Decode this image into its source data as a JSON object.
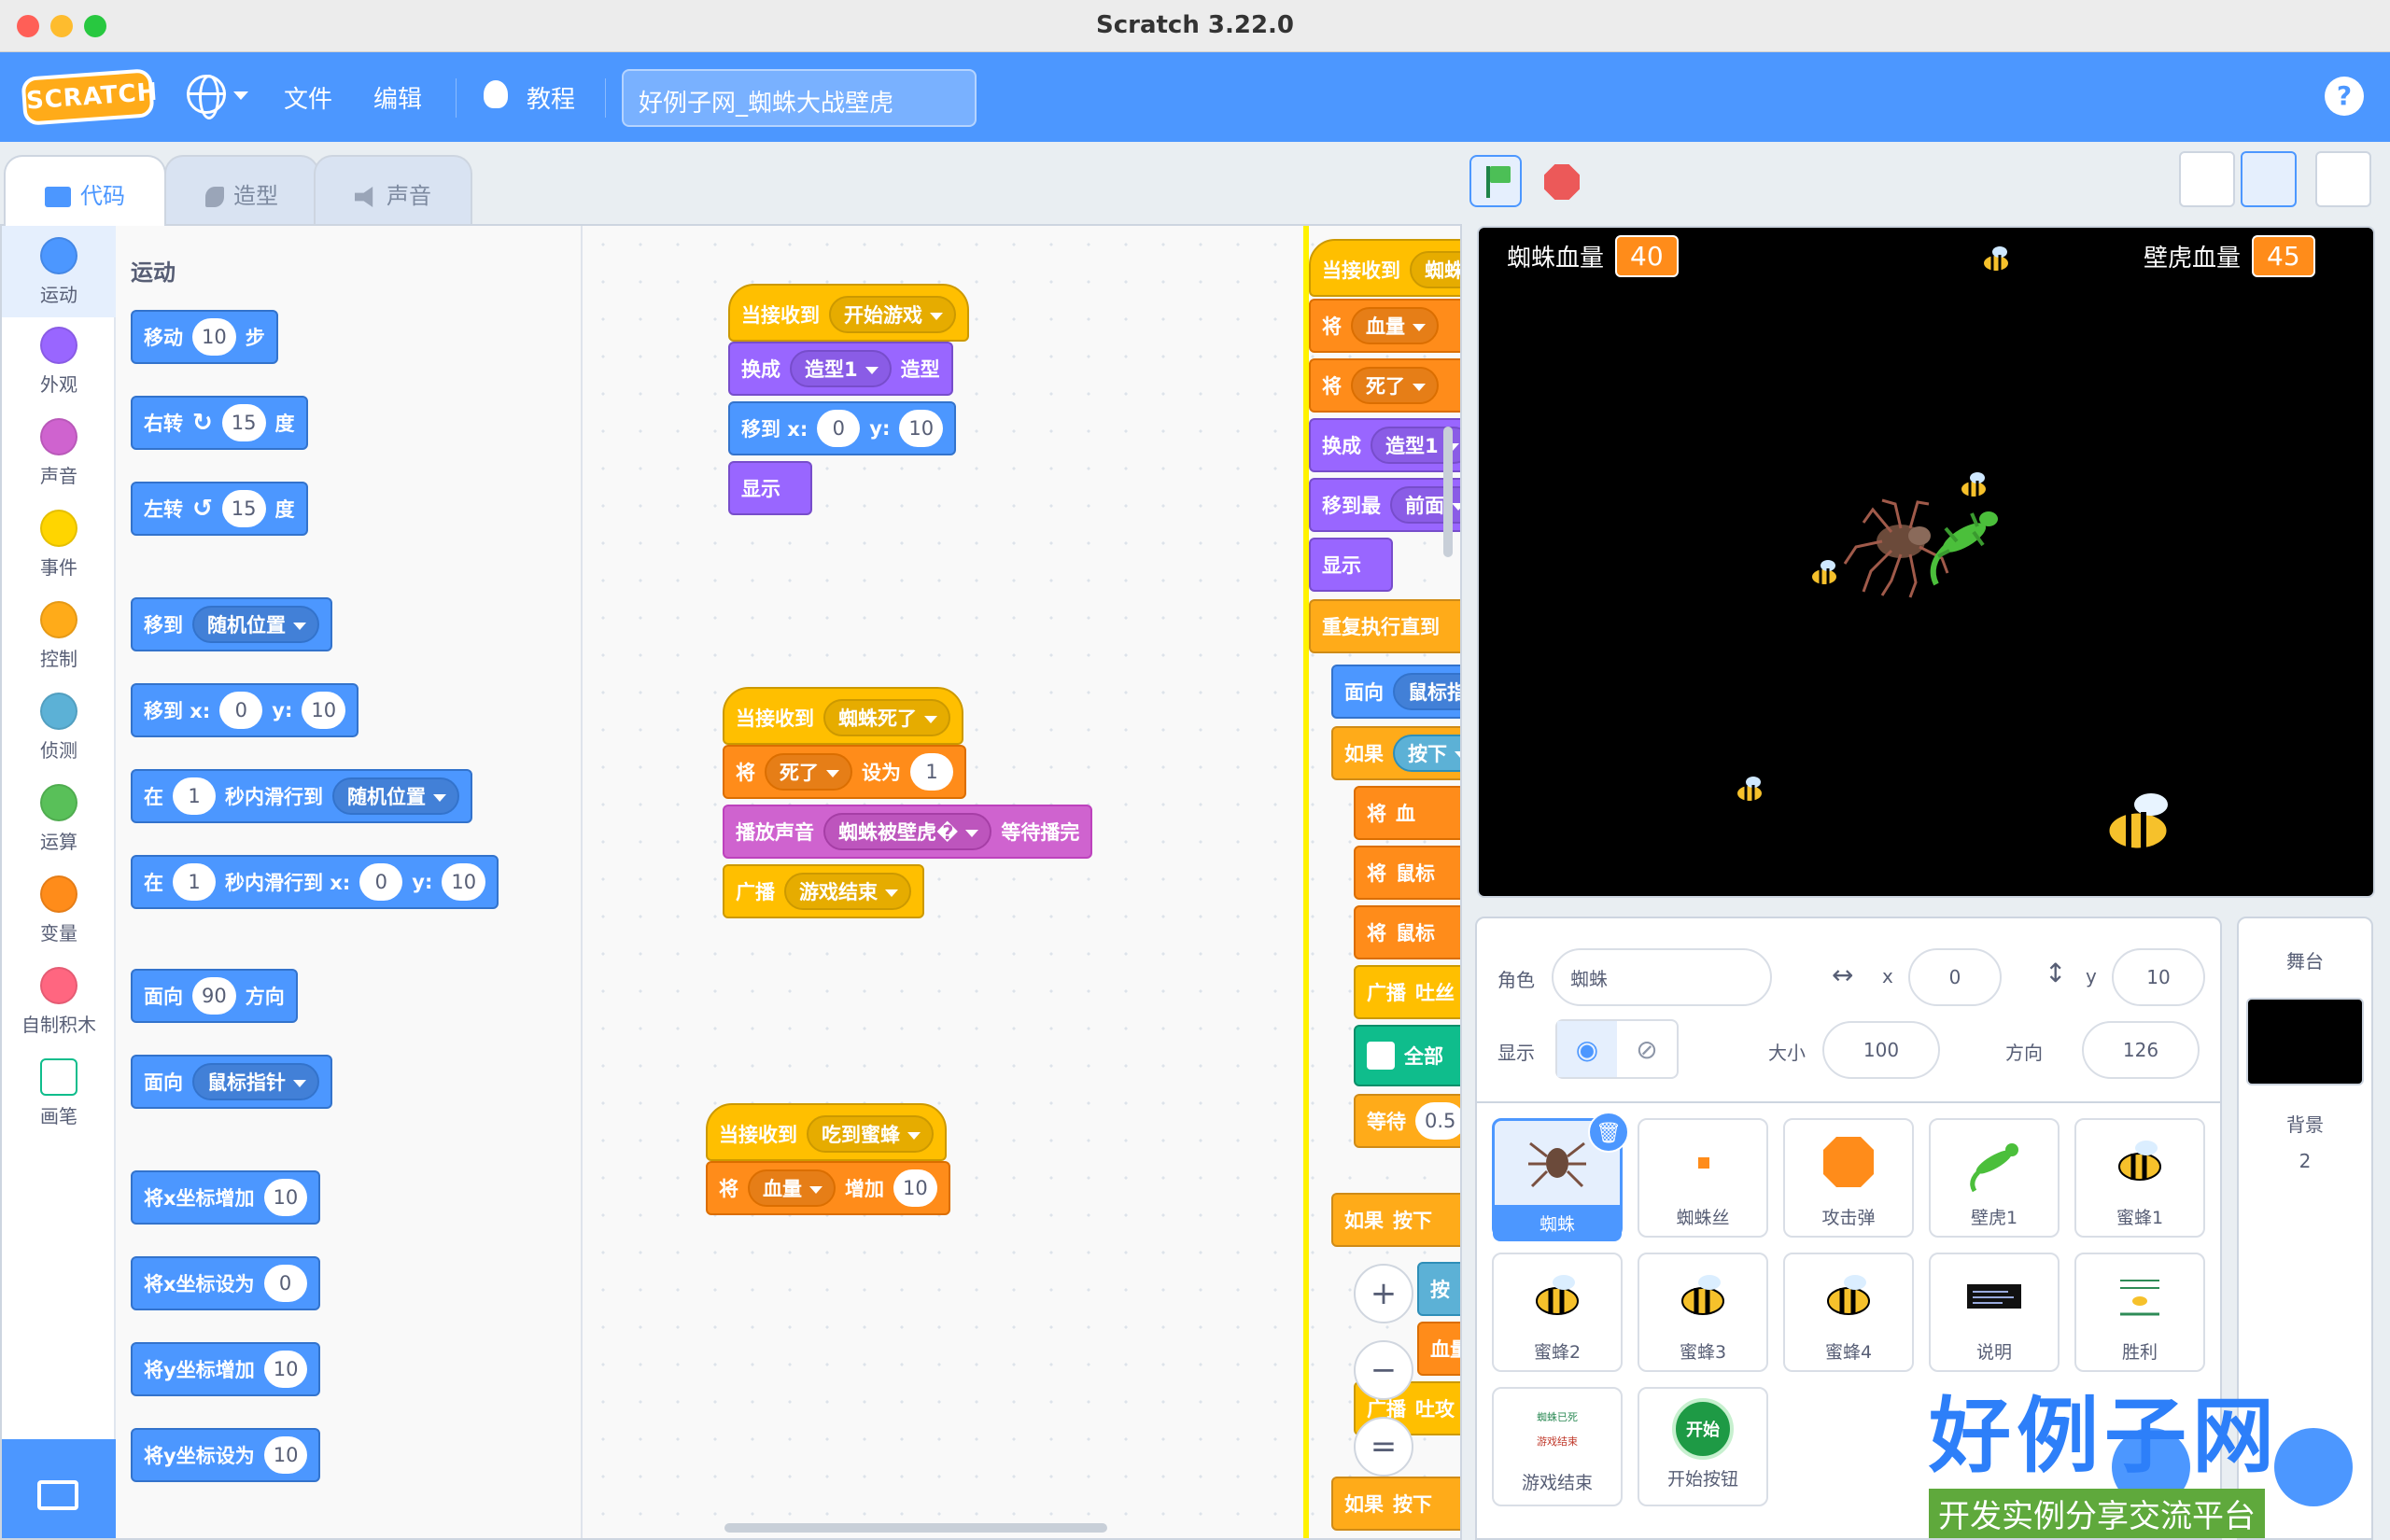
{
  "window": {
    "title": "Scratch 3.22.0"
  },
  "menubar": {
    "logo": "SCRATCH",
    "file": "文件",
    "edit": "编辑",
    "tutorials": "教程",
    "project_title": "好例子网_蜘蛛大战壁虎",
    "help": "?"
  },
  "tabs": {
    "code": "代码",
    "costumes": "造型",
    "sounds": "声音"
  },
  "categories": [
    {
      "label": "运动",
      "color": "#4c97ff"
    },
    {
      "label": "外观",
      "color": "#9966ff"
    },
    {
      "label": "声音",
      "color": "#cf63cf"
    },
    {
      "label": "事件",
      "color": "#ffd500"
    },
    {
      "label": "控制",
      "color": "#ffab19"
    },
    {
      "label": "侦测",
      "color": "#5cb1d6"
    },
    {
      "label": "运算",
      "color": "#59c059"
    },
    {
      "label": "变量",
      "color": "#ff8c1a"
    },
    {
      "label": "自制积木",
      "color": "#ff6680"
    },
    {
      "label": "画笔",
      "color": "#0fbd8c"
    }
  ],
  "palette": {
    "title": "运动",
    "move": {
      "a": "移动",
      "n": "10",
      "b": "步"
    },
    "turn_right": {
      "a": "右转",
      "icon": "↻",
      "n": "15",
      "b": "度"
    },
    "turn_left": {
      "a": "左转",
      "icon": "↺",
      "n": "15",
      "b": "度"
    },
    "goto": {
      "a": "移到",
      "d": "随机位置"
    },
    "goto_xy": {
      "a": "移到 x:",
      "x": "0",
      "yl": "y:",
      "y": "10"
    },
    "glide": {
      "a": "在",
      "n": "1",
      "b": "秒内滑行到",
      "d": "随机位置"
    },
    "glide_xy": {
      "a": "在",
      "n": "1",
      "b": "秒内滑行到 x:",
      "x": "0",
      "yl": "y:",
      "y": "10"
    },
    "point": {
      "a": "面向",
      "n": "90",
      "b": "方向"
    },
    "point_towards": {
      "a": "面向",
      "d": "鼠标指针"
    },
    "change_x": {
      "a": "将x坐标增加",
      "n": "10"
    },
    "set_x": {
      "a": "将x坐标设为",
      "n": "0"
    },
    "change_y": {
      "a": "将y坐标增加",
      "n": "10"
    },
    "set_y": {
      "a": "将y坐标设为",
      "n": "10"
    }
  },
  "script1": {
    "hat": {
      "a": "当接收到",
      "d": "开始游戏"
    },
    "costume": {
      "a": "换成",
      "d": "造型1",
      "b": "造型"
    },
    "goto": {
      "a": "移到 x:",
      "x": "0",
      "yl": "y:",
      "y": "10"
    },
    "show": "显示"
  },
  "script2": {
    "hat": {
      "a": "当接收到",
      "d": "蜘蛛死了"
    },
    "setvar": {
      "a": "将",
      "d": "死了",
      "b": "设为",
      "n": "1"
    },
    "play": {
      "a": "播放声音",
      "d": "蜘蛛被壁虎�",
      "b": "等待播完"
    },
    "broadcast": {
      "a": "广播",
      "d": "游戏结束"
    }
  },
  "script3": {
    "hat": {
      "a": "当接收到",
      "d": "吃到蜜蜂"
    },
    "change": {
      "a": "将",
      "d": "血量",
      "b": "增加",
      "n": "10"
    }
  },
  "script4": {
    "r1a": "当接收到",
    "r1d": "蜘蛛",
    "r2a": "将",
    "r2d": "血量",
    "r3a": "将",
    "r3d": "死了",
    "r4a": "换成",
    "r4d": "造型1",
    "r5a": "移到最",
    "r5d": "前面",
    "r6": "显示",
    "r7": "重复执行直到",
    "r8a": "面向",
    "r8d": "鼠标指",
    "r9a": "如果",
    "r9b": "按下",
    "r10a": "将",
    "r10b": "血",
    "r11a": "将",
    "r11b": "鼠标",
    "r12a": "将",
    "r12b": "鼠标",
    "r13a": "广播",
    "r13b": "吐丝",
    "r14": "全部",
    "r15a": "等待",
    "r15n": "0.5",
    "r16a": "如果",
    "r16b": "按下",
    "r17": "按",
    "r18": "血量",
    "r19a": "广播",
    "r19b": "吐攻",
    "r20a": "如果",
    "r20b": "按下"
  },
  "stage": {
    "monitor1": {
      "label": "蜘蛛血量",
      "value": "40"
    },
    "monitor2": {
      "label": "壁虎血量",
      "value": "45"
    }
  },
  "sprite_info": {
    "sprite_label": "角色",
    "sprite_name": "蜘蛛",
    "x_label": "x",
    "x": "0",
    "y_label": "y",
    "y": "10",
    "show_label": "显示",
    "size_label": "大小",
    "size": "100",
    "direction_label": "方向",
    "direction": "126"
  },
  "sprites": [
    "蜘蛛",
    "蜘蛛丝",
    "攻击弹",
    "壁虎1",
    "蜜蜂1",
    "蜜蜂2",
    "蜜蜂3",
    "蜜蜂4",
    "说明",
    "胜利",
    "游戏结束",
    "开始按钮"
  ],
  "stage_pane": {
    "title": "舞台",
    "backdrops_label": "背景",
    "backdrops_count": "2"
  },
  "thumbs": {
    "start": "开始",
    "over1": "蜘蛛已死",
    "over2": "游戏结束"
  },
  "watermark": {
    "big": "好例子网",
    "small": "开发实例分享交流平台"
  }
}
